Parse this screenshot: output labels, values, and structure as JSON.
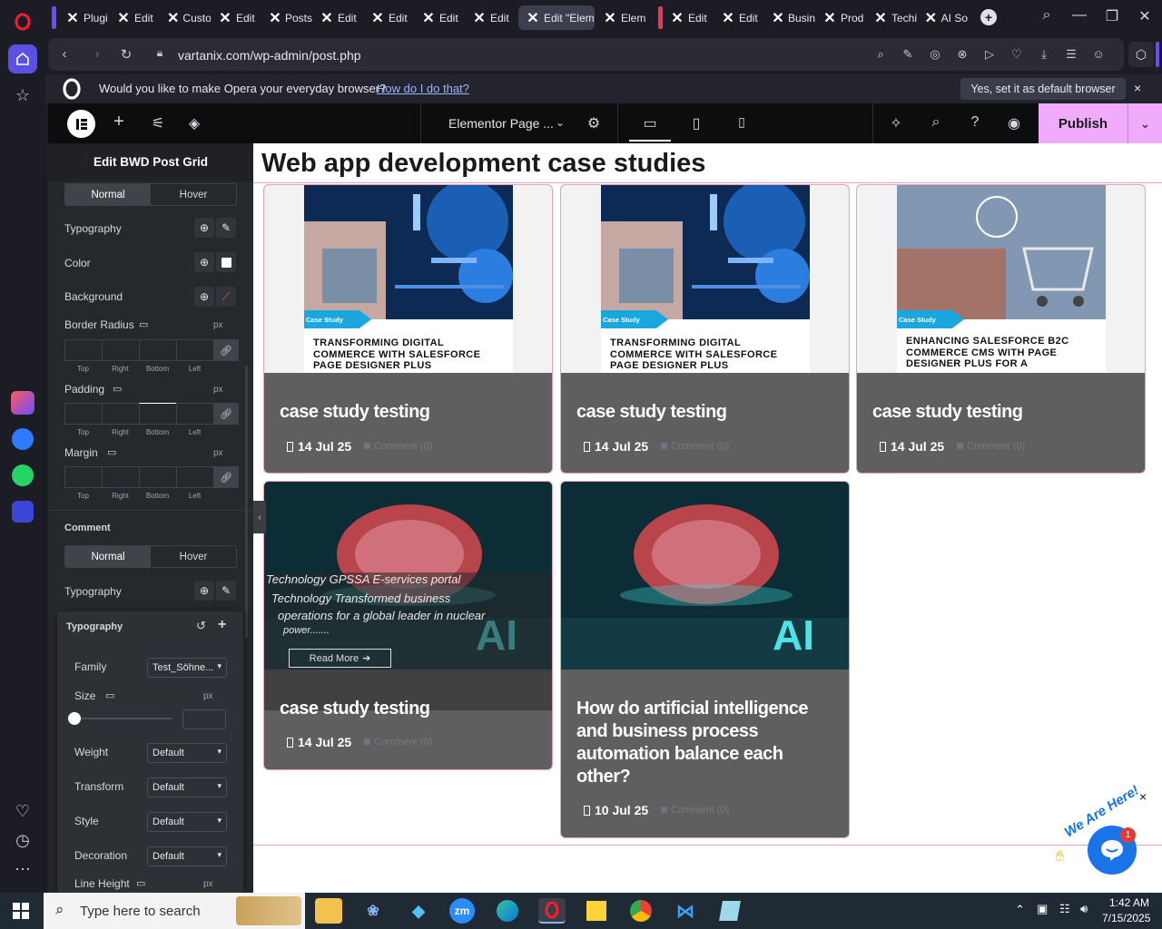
{
  "browser": {
    "tabs": [
      {
        "label": "Plugi"
      },
      {
        "label": "Edit"
      },
      {
        "label": "Custo"
      },
      {
        "label": "Edit"
      },
      {
        "label": "Posts"
      },
      {
        "label": "Edit"
      },
      {
        "label": "Edit"
      },
      {
        "label": "Edit"
      },
      {
        "label": "Edit"
      },
      {
        "label": "Edit \"Elem"
      },
      {
        "label": "Elem"
      },
      {
        "label": "Edit"
      },
      {
        "label": "Edit"
      },
      {
        "label": "Busin"
      },
      {
        "label": "Prod"
      },
      {
        "label": "Techi"
      },
      {
        "label": "AI So"
      }
    ],
    "url": "vartanix.com/wp-admin/post.php",
    "banner_text": "Would you like to make Opera your everyday browser?",
    "banner_link": "How do I do that?",
    "banner_button": "Yes, set it as default browser",
    "banner_close": "×"
  },
  "elementor": {
    "document_title": "Elementor Page ...",
    "publish_label": "Publish",
    "panel": {
      "title": "Edit BWD Post Grid",
      "state_tabs": [
        "Normal",
        "Hover"
      ],
      "typography_label": "Typography",
      "color_label": "Color",
      "background_label": "Background",
      "border_radius_label": "Border Radius",
      "padding_label": "Padding",
      "margin_label": "Margin",
      "unit": "px",
      "dim_labels": [
        "Top",
        "Right",
        "Bottom",
        "Left"
      ],
      "comment_label": "Comment",
      "comment_tabs": [
        "Normal",
        "Hover"
      ],
      "comment_typography_label": "Typography",
      "popover": {
        "title": "Typography",
        "family_label": "Family",
        "family_value": "Test_Söhne...",
        "size_label": "Size",
        "size_unit": "px",
        "weight_label": "Weight",
        "weight_value": "Default",
        "transform_label": "Transform",
        "transform_value": "Default",
        "style_label": "Style",
        "style_value": "Default",
        "decoration_label": "Decoration",
        "decoration_value": "Default",
        "line_height_label": "Line Height",
        "line_height_unit": "px"
      }
    }
  },
  "page": {
    "title": "Web app development case studies",
    "posts": [
      {
        "poster_tag": "Case Study",
        "poster_text": "TRANSFORMING DIGITAL COMMERCE WITH SALESFORCE PAGE DESIGNER PLUS",
        "title": "case study testing",
        "date": "14 Jul 25",
        "comment": "Comment (0)"
      },
      {
        "poster_tag": "Case Study",
        "poster_text": "TRANSFORMING DIGITAL COMMERCE WITH SALESFORCE PAGE DESIGNER PLUS",
        "title": "case study testing",
        "date": "14 Jul 25",
        "comment": "Comment (0)"
      },
      {
        "poster_tag": "Case Study",
        "poster_text": "ENHANCING SALESFORCE B2C COMMERCE CMS WITH PAGE DESIGNER PLUS FOR A",
        "title": "case study testing",
        "date": "14 Jul 25",
        "comment": "Comment (0)"
      },
      {
        "overlay_line1": "Technology GPSSA E-services portal",
        "overlay_line2": "Technology Transformed business",
        "overlay_line3": "operations for a global leader in nuclear",
        "overlay_line4": "power.......",
        "read_more": "Read More",
        "ai_text": "AI",
        "title": "case study testing",
        "date": "14 Jul 25",
        "comment": "Comment (0)"
      },
      {
        "ai_text": "AI",
        "title": "How do artificial intelligence and business process automation balance each other?",
        "date": "10 Jul 25",
        "comment": "Comment (0)"
      }
    ]
  },
  "chat_widget": {
    "tagline": "We Are Here!",
    "badge_count": "1",
    "close": "×"
  },
  "taskbar": {
    "search_placeholder": "Type here to search",
    "time": "1:42 AM",
    "date": "7/15/2025"
  }
}
